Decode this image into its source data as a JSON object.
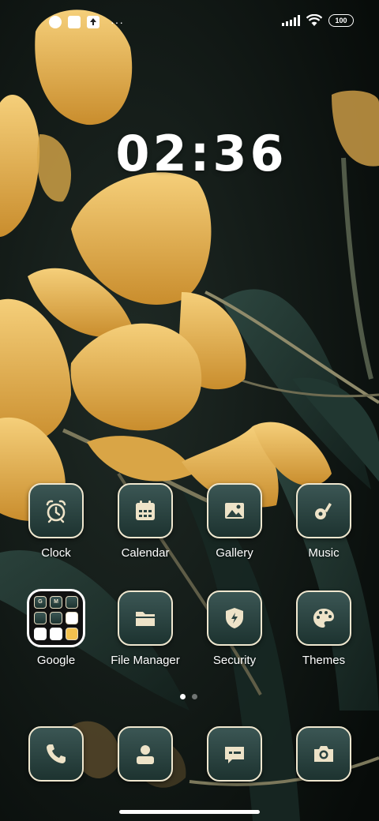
{
  "status_bar": {
    "left_icons": [
      "notification-app-icon",
      "square-icon",
      "upload-icon"
    ],
    "more_label": "···",
    "battery": "100"
  },
  "clock": {
    "time": "02:36"
  },
  "apps": [
    {
      "label": "Clock",
      "icon": "alarm-clock-icon"
    },
    {
      "label": "Calendar",
      "icon": "calendar-icon"
    },
    {
      "label": "Gallery",
      "icon": "image-icon"
    },
    {
      "label": "Music",
      "icon": "music-note-icon"
    },
    {
      "label": "Google",
      "icon": "folder-icon"
    },
    {
      "label": "File Manager",
      "icon": "folder-open-icon"
    },
    {
      "label": "Security",
      "icon": "shield-icon"
    },
    {
      "label": "Themes",
      "icon": "palette-icon"
    }
  ],
  "google_folder": {
    "mini_apps": [
      "G",
      "M",
      "",
      "",
      "",
      "",
      "",
      "",
      ""
    ]
  },
  "page_indicator": {
    "total": 2,
    "active": 1
  },
  "dock": [
    {
      "icon": "phone-icon"
    },
    {
      "icon": "contacts-icon"
    },
    {
      "icon": "messages-icon"
    },
    {
      "icon": "camera-icon"
    }
  ],
  "colors": {
    "tile_top": "#3b5654",
    "tile_bottom": "#1d3330",
    "tile_border": "#efe7cf",
    "icon_fill": "#eee3c8",
    "flower": "#e8b95a"
  }
}
